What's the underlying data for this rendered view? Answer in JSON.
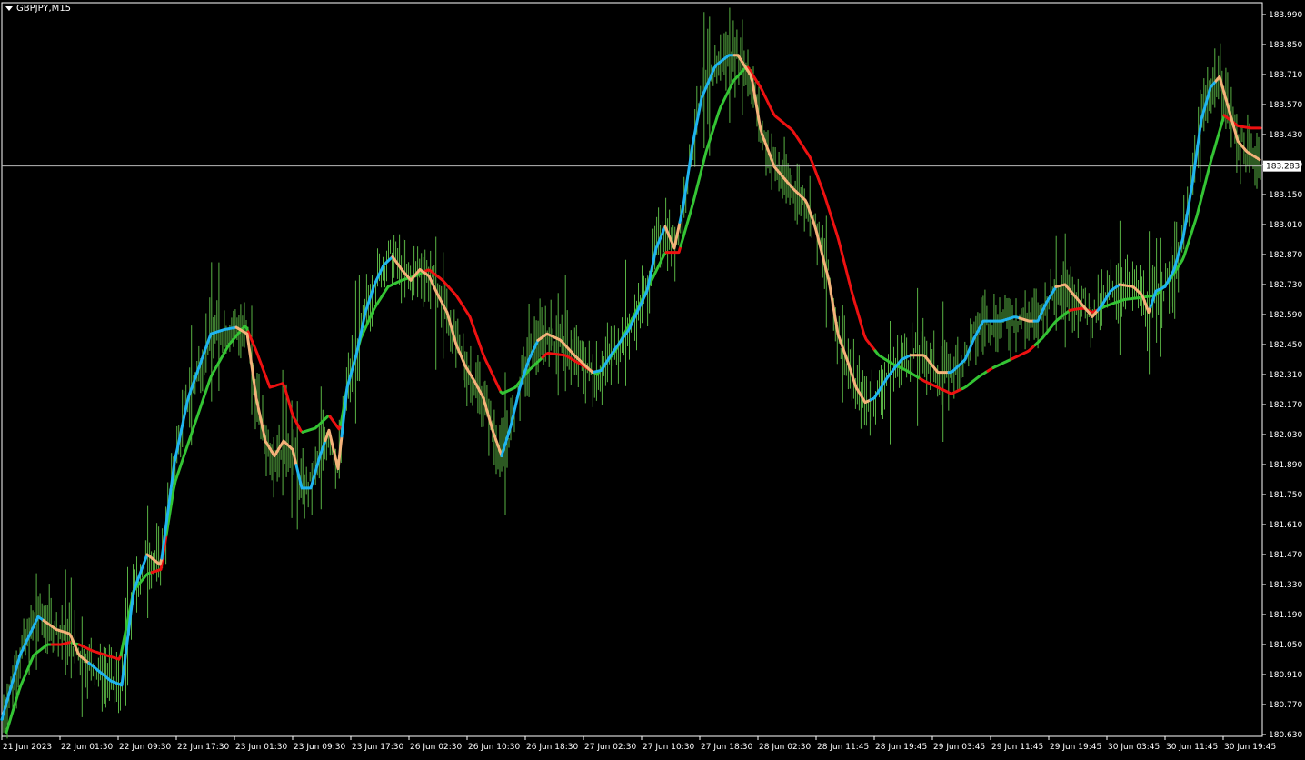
{
  "window": {
    "title": "GBPJPY,M15"
  },
  "colors": {
    "background": "#000000",
    "frame": "#ffffff",
    "bars": "#59b244",
    "fast_up": "#1fb4f0",
    "fast_down": "#f4b27a",
    "slow_up": "#34c434",
    "slow_down": "#ee1111",
    "price_line": "#b9b9b9"
  },
  "current_price": {
    "value": 183.283,
    "label": "183.283"
  },
  "chart_data": {
    "type": "line",
    "ylim": [
      180.63,
      183.99
    ],
    "y_ticks": [
      "183.990",
      "183.850",
      "183.710",
      "183.570",
      "183.430",
      "183.290",
      "183.150",
      "183.010",
      "182.870",
      "182.730",
      "182.590",
      "182.450",
      "182.310",
      "182.170",
      "182.030",
      "181.890",
      "181.750",
      "181.610",
      "181.470",
      "181.330",
      "181.190",
      "181.050",
      "180.910",
      "180.770",
      "180.630"
    ],
    "x_labels": [
      "21 Jun 2023",
      "22 Jun 01:30",
      "22 Jun 09:30",
      "22 Jun 17:30",
      "23 Jun 01:30",
      "23 Jun 09:30",
      "23 Jun 17:30",
      "26 Jun 02:30",
      "26 Jun 10:30",
      "26 Jun 18:30",
      "27 Jun 02:30",
      "27 Jun 10:30",
      "27 Jun 18:30",
      "28 Jun 02:30",
      "28 Jun 11:45",
      "28 Jun 19:45",
      "29 Jun 03:45",
      "29 Jun 11:45",
      "29 Jun 19:45",
      "30 Jun 03:45",
      "30 Jun 11:45",
      "30 Jun 19:45"
    ],
    "x_range": [
      0,
      1380
    ],
    "fast_ma": [
      [
        0,
        180.7
      ],
      [
        20,
        181.0
      ],
      [
        40,
        181.18
      ],
      [
        60,
        181.12
      ],
      [
        75,
        181.1
      ],
      [
        85,
        181.0
      ],
      [
        100,
        180.95
      ],
      [
        120,
        180.88
      ],
      [
        132,
        180.86
      ],
      [
        145,
        181.3
      ],
      [
        160,
        181.47
      ],
      [
        175,
        181.42
      ],
      [
        190,
        181.9
      ],
      [
        205,
        182.2
      ],
      [
        220,
        182.38
      ],
      [
        230,
        182.5
      ],
      [
        245,
        182.52
      ],
      [
        258,
        182.53
      ],
      [
        270,
        182.5
      ],
      [
        280,
        182.2
      ],
      [
        290,
        182.0
      ],
      [
        300,
        181.93
      ],
      [
        310,
        182.0
      ],
      [
        320,
        181.96
      ],
      [
        330,
        181.78
      ],
      [
        340,
        181.78
      ],
      [
        350,
        181.93
      ],
      [
        360,
        182.05
      ],
      [
        370,
        181.87
      ],
      [
        380,
        182.25
      ],
      [
        390,
        182.4
      ],
      [
        400,
        182.6
      ],
      [
        410,
        182.73
      ],
      [
        420,
        182.82
      ],
      [
        430,
        182.86
      ],
      [
        440,
        182.8
      ],
      [
        450,
        182.75
      ],
      [
        460,
        182.8
      ],
      [
        470,
        182.77
      ],
      [
        480,
        182.68
      ],
      [
        490,
        182.6
      ],
      [
        500,
        182.45
      ],
      [
        510,
        182.35
      ],
      [
        520,
        182.28
      ],
      [
        530,
        182.2
      ],
      [
        540,
        182.05
      ],
      [
        550,
        181.93
      ],
      [
        560,
        182.07
      ],
      [
        570,
        182.25
      ],
      [
        580,
        182.38
      ],
      [
        590,
        182.47
      ],
      [
        600,
        182.5
      ],
      [
        615,
        182.47
      ],
      [
        630,
        182.4
      ],
      [
        650,
        182.32
      ],
      [
        660,
        182.33
      ],
      [
        670,
        182.4
      ],
      [
        690,
        182.52
      ],
      [
        710,
        182.7
      ],
      [
        720,
        182.9
      ],
      [
        730,
        183.0
      ],
      [
        740,
        182.9
      ],
      [
        750,
        183.1
      ],
      [
        760,
        183.38
      ],
      [
        770,
        183.6
      ],
      [
        785,
        183.75
      ],
      [
        800,
        183.8
      ],
      [
        810,
        183.8
      ],
      [
        825,
        183.7
      ],
      [
        835,
        183.45
      ],
      [
        850,
        183.28
      ],
      [
        870,
        183.18
      ],
      [
        885,
        183.12
      ],
      [
        895,
        183.0
      ],
      [
        910,
        182.75
      ],
      [
        920,
        182.5
      ],
      [
        930,
        182.38
      ],
      [
        940,
        182.25
      ],
      [
        950,
        182.18
      ],
      [
        960,
        182.2
      ],
      [
        975,
        182.3
      ],
      [
        990,
        182.38
      ],
      [
        1000,
        182.4
      ],
      [
        1015,
        182.4
      ],
      [
        1030,
        182.32
      ],
      [
        1045,
        182.32
      ],
      [
        1060,
        182.38
      ],
      [
        1070,
        182.48
      ],
      [
        1080,
        182.56
      ],
      [
        1100,
        182.56
      ],
      [
        1115,
        182.58
      ],
      [
        1130,
        182.56
      ],
      [
        1140,
        182.56
      ],
      [
        1150,
        182.65
      ],
      [
        1160,
        182.72
      ],
      [
        1170,
        182.73
      ],
      [
        1180,
        182.68
      ],
      [
        1190,
        182.63
      ],
      [
        1200,
        182.58
      ],
      [
        1210,
        182.63
      ],
      [
        1220,
        182.7
      ],
      [
        1230,
        182.73
      ],
      [
        1245,
        182.72
      ],
      [
        1255,
        182.68
      ],
      [
        1262,
        182.6
      ],
      [
        1270,
        182.7
      ],
      [
        1280,
        182.72
      ],
      [
        1290,
        182.8
      ],
      [
        1300,
        182.95
      ],
      [
        1310,
        183.2
      ],
      [
        1320,
        183.5
      ],
      [
        1330,
        183.65
      ],
      [
        1340,
        183.7
      ],
      [
        1350,
        183.55
      ],
      [
        1360,
        183.4
      ],
      [
        1370,
        183.35
      ],
      [
        1385,
        183.31
      ]
    ],
    "fast_ma_down": [
      [
        45,
        181.18,
        95
      ],
      [
        160,
        175
      ],
      [
        258,
        322
      ],
      [
        355,
        372
      ],
      [
        430,
        548
      ],
      [
        590,
        650
      ],
      [
        730,
        745
      ],
      [
        805,
        955
      ],
      [
        1000,
        1040
      ],
      [
        1120,
        1135
      ],
      [
        1160,
        1205
      ],
      [
        1230,
        1262
      ],
      [
        1335,
        1385
      ]
    ],
    "slow_ma": [
      [
        5,
        180.64
      ],
      [
        20,
        180.85
      ],
      [
        35,
        181.0
      ],
      [
        50,
        181.05
      ],
      [
        65,
        181.05
      ],
      [
        75,
        181.06
      ],
      [
        85,
        181.05
      ],
      [
        100,
        181.02
      ],
      [
        115,
        181.0
      ],
      [
        130,
        180.98
      ],
      [
        145,
        181.3
      ],
      [
        160,
        181.38
      ],
      [
        175,
        181.4
      ],
      [
        190,
        181.8
      ],
      [
        210,
        182.05
      ],
      [
        230,
        182.3
      ],
      [
        250,
        182.45
      ],
      [
        268,
        182.54
      ],
      [
        280,
        182.42
      ],
      [
        295,
        182.25
      ],
      [
        310,
        182.27
      ],
      [
        320,
        182.12
      ],
      [
        330,
        182.04
      ],
      [
        345,
        182.06
      ],
      [
        360,
        182.12
      ],
      [
        372,
        182.05
      ],
      [
        380,
        182.25
      ],
      [
        395,
        182.48
      ],
      [
        410,
        182.62
      ],
      [
        425,
        182.72
      ],
      [
        440,
        182.75
      ],
      [
        455,
        182.77
      ],
      [
        470,
        182.8
      ],
      [
        485,
        182.75
      ],
      [
        500,
        182.68
      ],
      [
        515,
        182.58
      ],
      [
        530,
        182.4
      ],
      [
        550,
        182.22
      ],
      [
        565,
        182.25
      ],
      [
        580,
        182.33
      ],
      [
        600,
        182.41
      ],
      [
        620,
        182.4
      ],
      [
        640,
        182.35
      ],
      [
        655,
        182.31
      ],
      [
        675,
        182.42
      ],
      [
        695,
        182.58
      ],
      [
        715,
        182.75
      ],
      [
        730,
        182.88
      ],
      [
        745,
        182.88
      ],
      [
        760,
        183.1
      ],
      [
        775,
        183.35
      ],
      [
        790,
        183.55
      ],
      [
        805,
        183.68
      ],
      [
        820,
        183.75
      ],
      [
        835,
        183.65
      ],
      [
        850,
        183.52
      ],
      [
        870,
        183.45
      ],
      [
        890,
        183.32
      ],
      [
        905,
        183.15
      ],
      [
        920,
        182.95
      ],
      [
        935,
        182.7
      ],
      [
        950,
        182.48
      ],
      [
        965,
        182.4
      ],
      [
        980,
        182.36
      ],
      [
        995,
        182.33
      ],
      [
        1015,
        182.28
      ],
      [
        1030,
        182.25
      ],
      [
        1045,
        182.22
      ],
      [
        1060,
        182.25
      ],
      [
        1075,
        182.3
      ],
      [
        1090,
        182.34
      ],
      [
        1110,
        182.38
      ],
      [
        1130,
        182.42
      ],
      [
        1145,
        182.48
      ],
      [
        1160,
        182.56
      ],
      [
        1175,
        182.61
      ],
      [
        1190,
        182.62
      ],
      [
        1200,
        182.6
      ],
      [
        1215,
        182.63
      ],
      [
        1235,
        182.66
      ],
      [
        1255,
        182.67
      ],
      [
        1270,
        182.68
      ],
      [
        1285,
        182.75
      ],
      [
        1300,
        182.85
      ],
      [
        1315,
        183.05
      ],
      [
        1330,
        183.3
      ],
      [
        1345,
        183.52
      ],
      [
        1360,
        183.47
      ],
      [
        1375,
        183.46
      ],
      [
        1385,
        183.46
      ]
    ],
    "slow_ma_down": [
      [
        55,
        75
      ],
      [
        85,
        130
      ],
      [
        165,
        180
      ],
      [
        270,
        330
      ],
      [
        360,
        372
      ],
      [
        465,
        548
      ],
      [
        595,
        650
      ],
      [
        730,
        745
      ],
      [
        820,
        960
      ],
      [
        1010,
        1055
      ],
      [
        1085,
        1090
      ],
      [
        1110,
        1135
      ],
      [
        1175,
        1205
      ],
      [
        1345,
        1385
      ]
    ],
    "bars_seed": 7,
    "bars_count": 690
  }
}
